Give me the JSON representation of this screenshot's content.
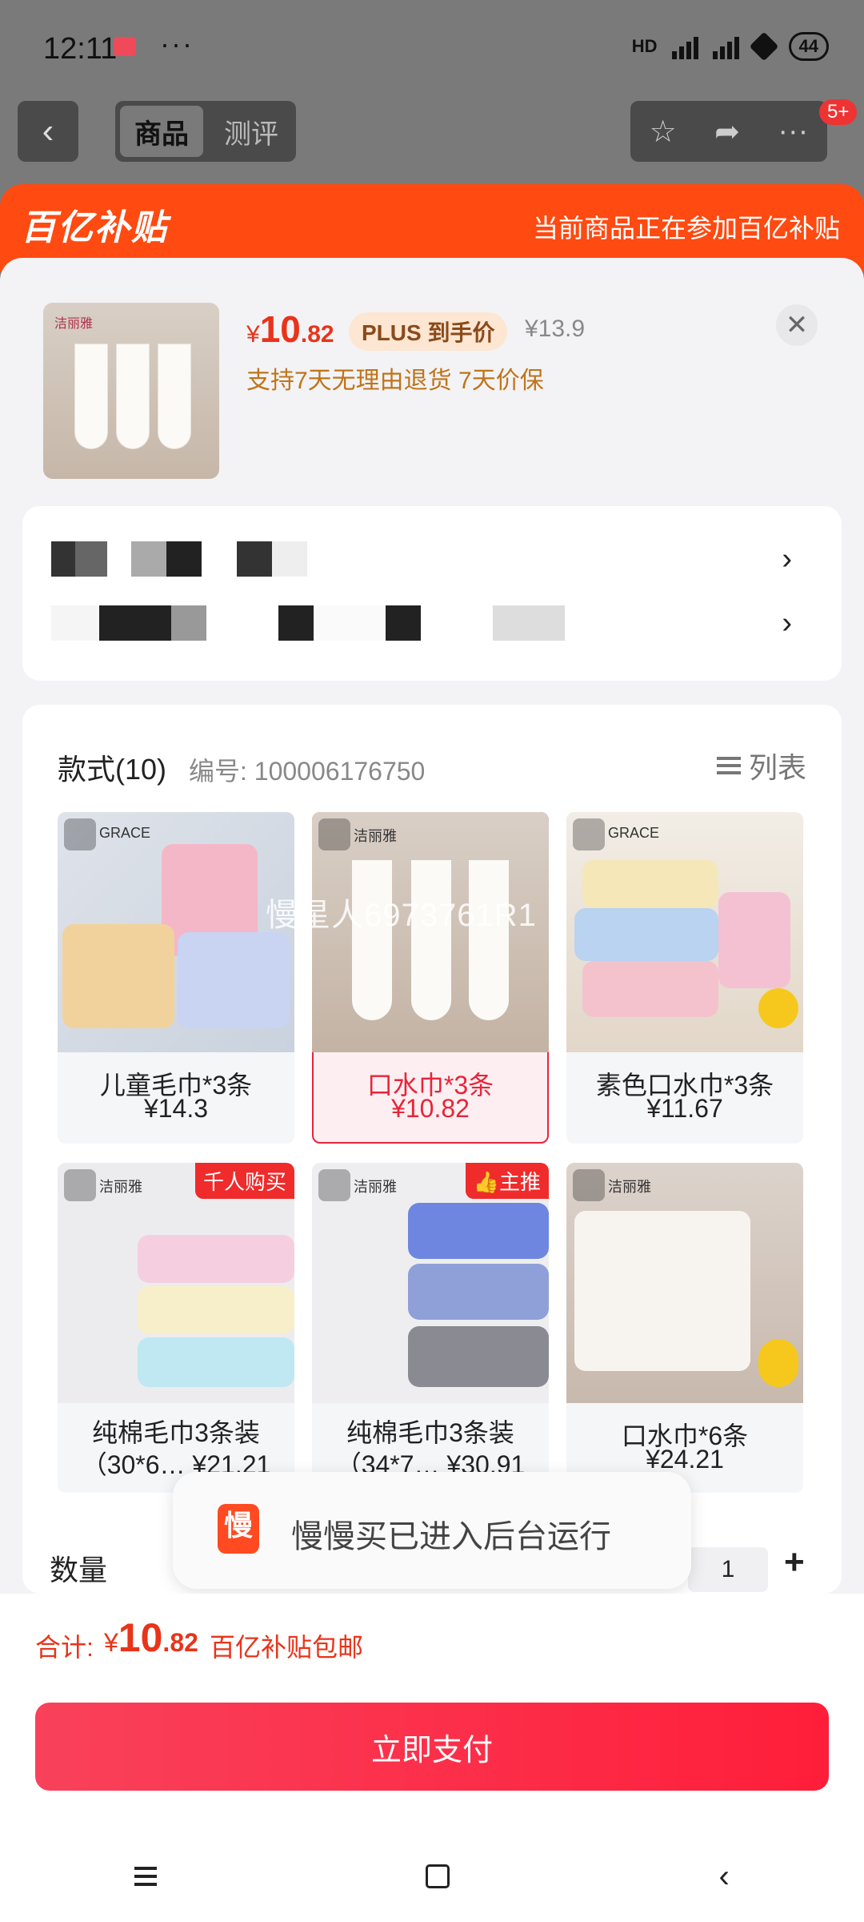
{
  "status_bar": {
    "time": "12:11",
    "dots": "···",
    "network": "HD",
    "battery": "44"
  },
  "header": {
    "tabs": [
      "商品",
      "测评"
    ],
    "badge": "5+"
  },
  "banner": {
    "logo": "百亿补贴",
    "note": "当前商品正在参加百亿补贴"
  },
  "product": {
    "brand": "洁丽雅",
    "price_yen": "¥",
    "price_int": "10",
    "price_dec": ".82",
    "plus_tag": "PLUS 到手价",
    "orig_price": "¥13.9",
    "services": "支持7天无理由退货  7天价保"
  },
  "specs": {
    "title": "款式(10)",
    "code": "编号: 100006176750",
    "list_label": "列表",
    "options": [
      {
        "name": "儿童毛巾*3条",
        "price": "¥14.3",
        "brand": "GRACE"
      },
      {
        "name": "口水巾*3条",
        "price": "¥10.82",
        "brand": "洁丽雅"
      },
      {
        "name": "素色口水巾*3条",
        "price": "¥11.67",
        "brand": "GRACE"
      },
      {
        "name": "纯棉毛巾3条装",
        "sub": "（30*6… ¥21.21",
        "brand": "洁丽雅",
        "badge": "千人购买"
      },
      {
        "name": "纯棉毛巾3条装",
        "sub": "（34*7… ¥30.91",
        "brand": "洁丽雅",
        "badge": "主推"
      },
      {
        "name": "口水巾*6条",
        "price": "¥24.21",
        "brand": "洁丽雅"
      }
    ],
    "watermark": "慢星人6973761R1"
  },
  "quantity": {
    "label": "数量",
    "value": "1",
    "plus": "+"
  },
  "toast": {
    "icon": "慢",
    "text": "慢慢买已进入后台运行"
  },
  "footer": {
    "total_label": "合计:",
    "total_yen": "¥",
    "total_int": "10",
    "total_dec": ".82",
    "shipping": "百亿补贴包邮",
    "pay_button": "立即支付"
  },
  "colors": {
    "accent": "#e8341a",
    "banner": "#ff4a11",
    "pay": "#ff1e3a"
  }
}
